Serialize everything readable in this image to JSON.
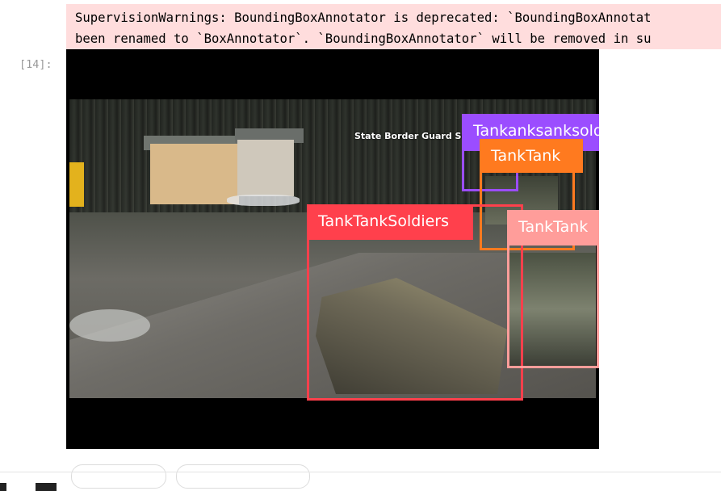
{
  "warning": {
    "line1": "SupervisionWarnings: BoundingBoxAnnotator is deprecated: `BoundingBoxAnnotat",
    "line2": "been renamed to `BoxAnnotator`. `BoundingBoxAnnotator` will be removed in su"
  },
  "cell": {
    "prompt": "[14]:"
  },
  "video": {
    "caption": "State Border Guard Se",
    "labels": [
      {
        "text": "Tankanksanksoldiers",
        "color": "#9b4dff"
      },
      {
        "text": "TankTank",
        "color": "#ff7a1f"
      },
      {
        "text": "TankTankSoldiers",
        "color": "#ff404c"
      },
      {
        "text": "TankTank",
        "color": "#ff9d9a"
      }
    ]
  }
}
